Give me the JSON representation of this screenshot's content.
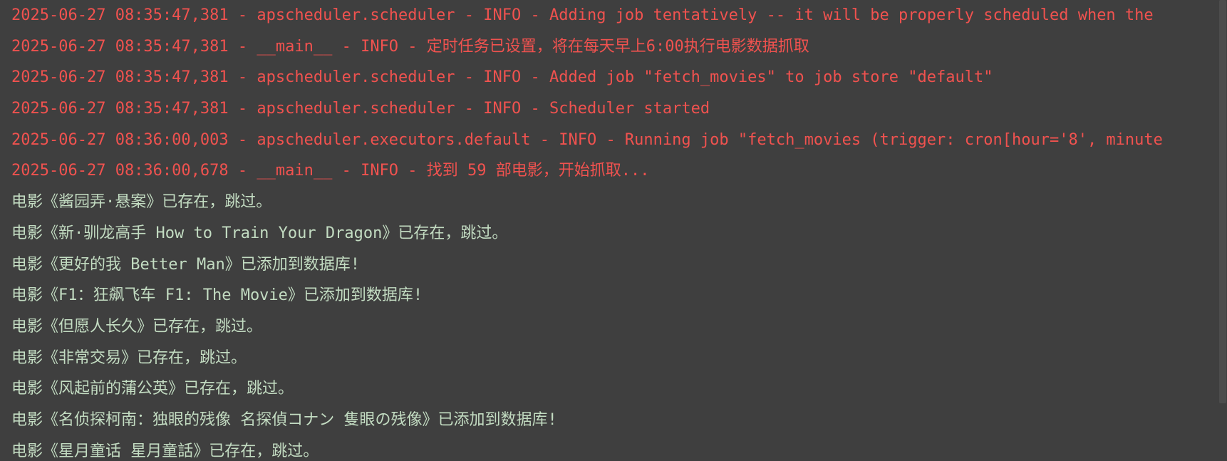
{
  "console": {
    "lines": [
      {
        "text": "2025-06-27 08:35:47,381 - apscheduler.scheduler - INFO - Adding job tentatively -- it will be properly scheduled when the",
        "kind": "stderr"
      },
      {
        "text": "2025-06-27 08:35:47,381 - __main__ - INFO - 定时任务已设置，将在每天早上6:00执行电影数据抓取",
        "kind": "stderr"
      },
      {
        "text": "2025-06-27 08:35:47,381 - apscheduler.scheduler - INFO - Added job \"fetch_movies\" to job store \"default\"",
        "kind": "stderr"
      },
      {
        "text": "2025-06-27 08:35:47,381 - apscheduler.scheduler - INFO - Scheduler started",
        "kind": "stderr"
      },
      {
        "text": "2025-06-27 08:36:00,003 - apscheduler.executors.default - INFO - Running job \"fetch_movies (trigger: cron[hour='8', minute",
        "kind": "stderr"
      },
      {
        "text": "2025-06-27 08:36:00,678 - __main__ - INFO - 找到 59 部电影，开始抓取...",
        "kind": "stderr"
      },
      {
        "text": "电影《酱园弄·悬案》已存在，跳过。",
        "kind": "stdout"
      },
      {
        "text": "电影《新·驯龙高手 How to Train Your Dragon》已存在，跳过。",
        "kind": "stdout"
      },
      {
        "text": "电影《更好的我 Better Man》已添加到数据库!",
        "kind": "stdout"
      },
      {
        "text": "电影《F1：狂飙飞车 F1: The Movie》已添加到数据库!",
        "kind": "stdout"
      },
      {
        "text": "电影《但愿人长久》已存在，跳过。",
        "kind": "stdout"
      },
      {
        "text": "电影《非常交易》已存在，跳过。",
        "kind": "stdout"
      },
      {
        "text": "电影《风起前的蒲公英》已存在，跳过。",
        "kind": "stdout"
      },
      {
        "text": "电影《名侦探柯南：独眼的残像 名探偵コナン 隻眼の残像》已添加到数据库!",
        "kind": "stdout"
      },
      {
        "text": "电影《星月童话 星月童話》已存在，跳过。",
        "kind": "stdout"
      }
    ],
    "colors": {
      "background": "#3f3f3f",
      "stderr": "#f0524f",
      "stdout": "#c3dcc2",
      "scrollbar_thumb": "#4c4c4c"
    }
  }
}
